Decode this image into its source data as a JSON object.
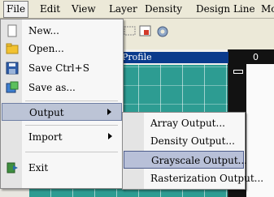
{
  "menubar": {
    "items": [
      "File",
      "Edit",
      "View",
      "Layer",
      "Density",
      "Design Line",
      "Mo"
    ]
  },
  "panels": {
    "profile_title": "Profile",
    "right_title": "0"
  },
  "file_menu": {
    "items": [
      {
        "label": "New...",
        "icon": "new-file-icon"
      },
      {
        "label": "Open...",
        "icon": "folder-open-icon"
      },
      {
        "label": "Save  Ctrl+S",
        "icon": "floppy-save-icon"
      },
      {
        "label": "Save as...",
        "icon": "save-as-icon"
      },
      {
        "label": "Output",
        "icon": "",
        "submenu": true
      },
      {
        "label": "Import",
        "icon": "",
        "submenu": true
      },
      {
        "label": "Exit",
        "icon": "exit-icon"
      }
    ]
  },
  "output_submenu": {
    "items": [
      "Array Output...",
      "Density Output...",
      "Grayscale Output...",
      "Rasterization Output..."
    ],
    "selected": "Grayscale Output..."
  },
  "colors": {
    "menu_highlight": "#bcc4d6",
    "profile_header": "#0a3a8c",
    "grid": "#2d9c92"
  }
}
